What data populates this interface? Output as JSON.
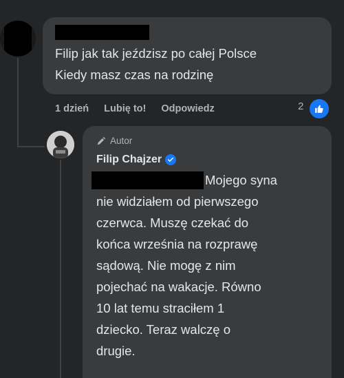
{
  "comment": {
    "text_lines": "Filip jak tak jeździsz po całej Polsce\nKiedy masz czas na rodzinę",
    "time": "1 dzień",
    "like_label": "Lubię to!",
    "reply_label": "Odpowiedz",
    "reaction_count": "2"
  },
  "reply": {
    "author_tag": "Autor",
    "author_name": "Filip Chajzer",
    "text_first": "Mojego syna",
    "text_rest": "nie widziałem od pierwszego\nczerwca. Muszę czekać do\nkońca września na rozprawę\nsądową. Nie mogę z nim\npojechać na wakacje. Równo\n10 lat temu straciłem 1\ndziecko. Teraz walczę o\ndrugie."
  },
  "colors": {
    "background": "#242526",
    "bubble": "#3a3b3c",
    "accent": "#1877f2",
    "text": "#e4e6eb",
    "secondary_text": "#b0b3b8"
  }
}
